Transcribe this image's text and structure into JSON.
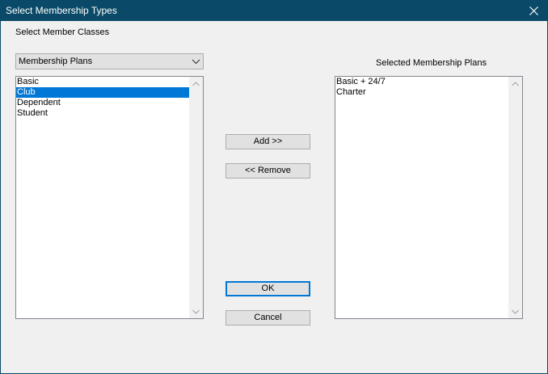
{
  "window": {
    "title": "Select Membership Types"
  },
  "icons": {
    "close": "close-icon",
    "dropdown": "chevron-down-icon",
    "scroll_up": "chevron-up-icon",
    "scroll_down": "chevron-down-icon"
  },
  "member_classes": {
    "label": "Select Member Classes",
    "combo_value": "Membership Plans",
    "items": [
      "Basic",
      "Club",
      "Dependent",
      "Student"
    ],
    "selected_index": 1
  },
  "selected_plans": {
    "label": "Selected Membership Plans",
    "items": [
      "Basic + 24/7",
      "Charter"
    ]
  },
  "buttons": {
    "add": "Add >>",
    "remove": "<< Remove",
    "ok": "OK",
    "cancel": "Cancel"
  },
  "colors": {
    "titlebar": "#0a4a68",
    "selection": "#0078d7",
    "default_button_border": "#0078d7"
  }
}
